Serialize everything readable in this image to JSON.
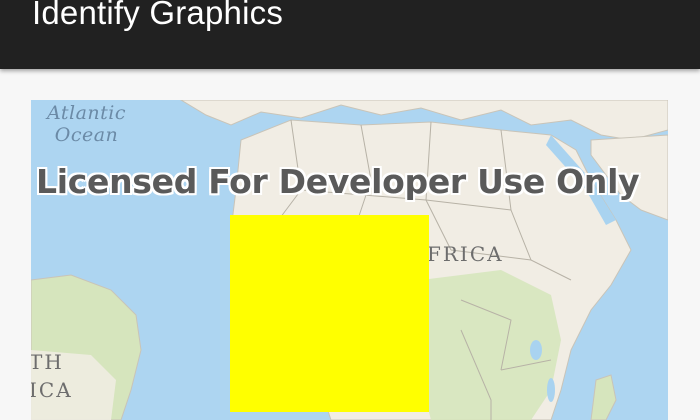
{
  "app_bar": {
    "title": "Identify Graphics",
    "background_color": "#212121"
  },
  "map": {
    "ocean_label_line1": "Atlantic",
    "ocean_label_line2": "Ocean",
    "africa_label": "FRICA",
    "south_africa_label_line1": "TH",
    "south_africa_label_line2": "ICA",
    "watermark": "Licensed For Developer Use Only",
    "ocean_color": "#a9d3f0",
    "land_color": "#f1ede4",
    "vegetation_color": "#d6e5bd"
  },
  "graphic": {
    "shape": "square",
    "fill_color": "#ffff00"
  }
}
